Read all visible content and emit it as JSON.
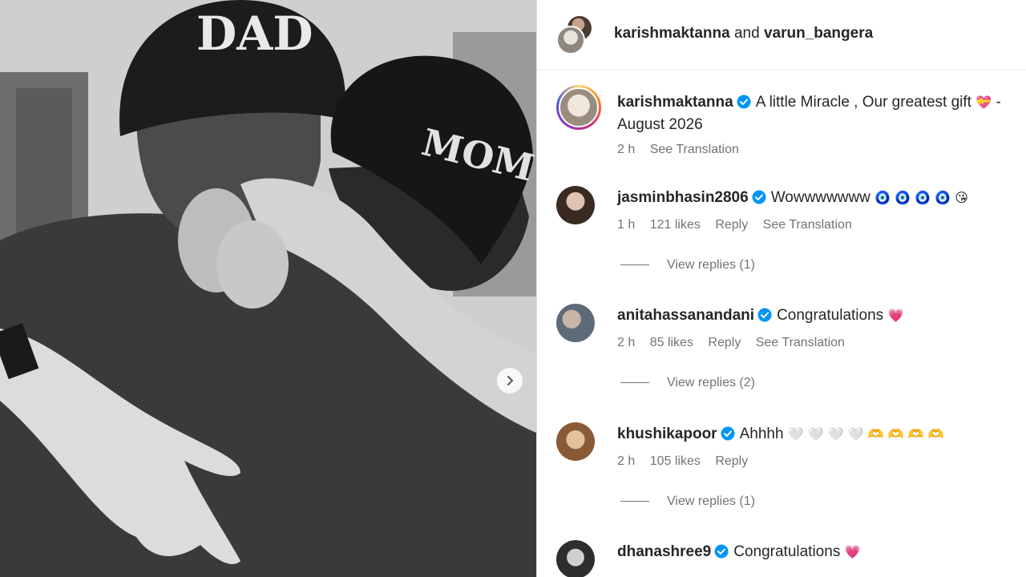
{
  "photo": {
    "cap_left_text": "DAD",
    "cap_right_text": "MOM",
    "next_icon": "chevron-right-icon"
  },
  "header": {
    "user1": "karishmaktanna",
    "joiner": "and",
    "user2": "varun_bangera"
  },
  "caption": {
    "username": "karishmaktanna",
    "text": "A little Miracle , Our greatest gift",
    "emoji": "💝",
    "dash": "-",
    "line2": "August 2026",
    "time": "2 h",
    "translation": "See Translation"
  },
  "comments": [
    {
      "username": "jasminbhasin2806",
      "text": "Wowwwwwww",
      "emoji": "🧿 🧿 🧿 🧿 😘",
      "time": "1 h",
      "likes": "121 likes",
      "reply": "Reply",
      "translation": "See Translation",
      "replies": "View replies (1)"
    },
    {
      "username": "anitahassanandani",
      "text": "Congratulations",
      "emoji": "💗",
      "time": "2 h",
      "likes": "85 likes",
      "reply": "Reply",
      "translation": "See Translation",
      "replies": "View replies (2)"
    },
    {
      "username": "khushikapoor",
      "text": "Ahhhh",
      "emoji": "🤍 🤍 🤍 🤍 🫶 🫶 🫶 🫶",
      "time": "2 h",
      "likes": "105 likes",
      "reply": "Reply",
      "translation": "",
      "replies": "View replies (1)"
    },
    {
      "username": "dhanashree9",
      "text": "Congratulations",
      "emoji": "💗",
      "time": "",
      "likes": "",
      "reply": "",
      "translation": "",
      "replies": ""
    }
  ],
  "colors": {
    "verified": "#0095f6",
    "meta_text": "#737373",
    "primary_text": "#262626"
  }
}
